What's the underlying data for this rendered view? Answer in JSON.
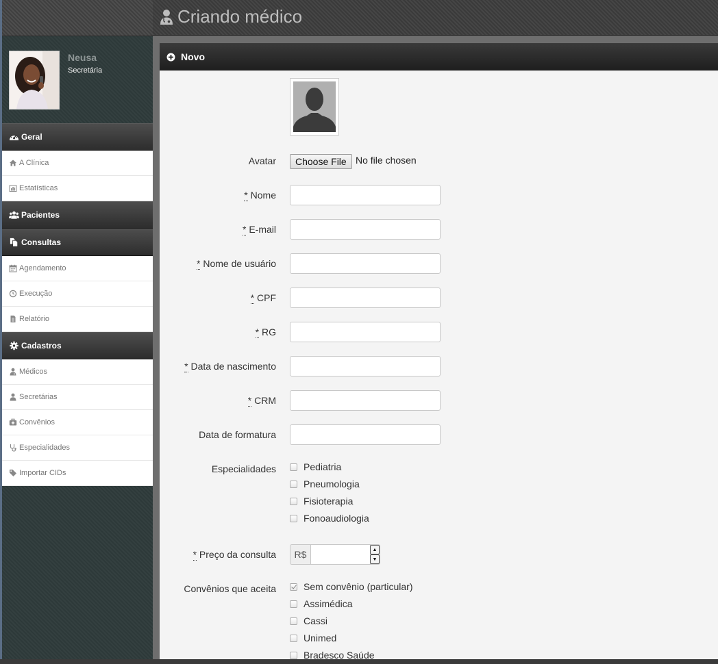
{
  "header": {
    "title": "Criando médico"
  },
  "user": {
    "name": "Neusa",
    "role": "Secretária"
  },
  "sidebar": {
    "sections": [
      {
        "label": "Geral",
        "items": [
          {
            "label": "A Clínica"
          },
          {
            "label": "Estatísticas"
          }
        ]
      },
      {
        "label": "Pacientes",
        "items": []
      },
      {
        "label": "Consultas",
        "items": [
          {
            "label": "Agendamento"
          },
          {
            "label": "Execução"
          },
          {
            "label": "Relatório"
          }
        ]
      },
      {
        "label": "Cadastros",
        "items": [
          {
            "label": "Médicos"
          },
          {
            "label": "Secretárias"
          },
          {
            "label": "Convênios"
          },
          {
            "label": "Especialidades"
          },
          {
            "label": "Importar CIDs"
          }
        ]
      }
    ]
  },
  "panel": {
    "title": "Novo"
  },
  "form": {
    "avatar_label": "Avatar",
    "file_button": "Choose File",
    "file_status": "No file chosen",
    "required_mark": "*",
    "fields": [
      {
        "label": "Nome",
        "required": true,
        "value": ""
      },
      {
        "label": "E-mail",
        "required": true,
        "value": ""
      },
      {
        "label": "Nome de usuário",
        "required": true,
        "value": ""
      },
      {
        "label": "CPF",
        "required": true,
        "value": ""
      },
      {
        "label": "RG",
        "required": true,
        "value": ""
      },
      {
        "label": "Data de nascimento",
        "required": true,
        "value": ""
      },
      {
        "label": "CRM",
        "required": true,
        "value": ""
      },
      {
        "label": "Data de formatura",
        "required": false,
        "value": ""
      }
    ],
    "especialidades": {
      "label": "Especialidades",
      "options": [
        {
          "label": "Pediatria",
          "checked": false
        },
        {
          "label": "Pneumologia",
          "checked": false
        },
        {
          "label": "Fisioterapia",
          "checked": false
        },
        {
          "label": "Fonoaudiologia",
          "checked": false
        }
      ]
    },
    "preco": {
      "label": "Preço da consulta",
      "prefix": "R$",
      "value": ""
    },
    "convenios": {
      "label": "Convênios que aceita",
      "options": [
        {
          "label": "Sem convênio (particular)",
          "checked": true
        },
        {
          "label": "Assimédica",
          "checked": false
        },
        {
          "label": "Cassi",
          "checked": false
        },
        {
          "label": "Unimed",
          "checked": false
        },
        {
          "label": "Bradesco Saúde",
          "checked": false
        }
      ]
    }
  }
}
